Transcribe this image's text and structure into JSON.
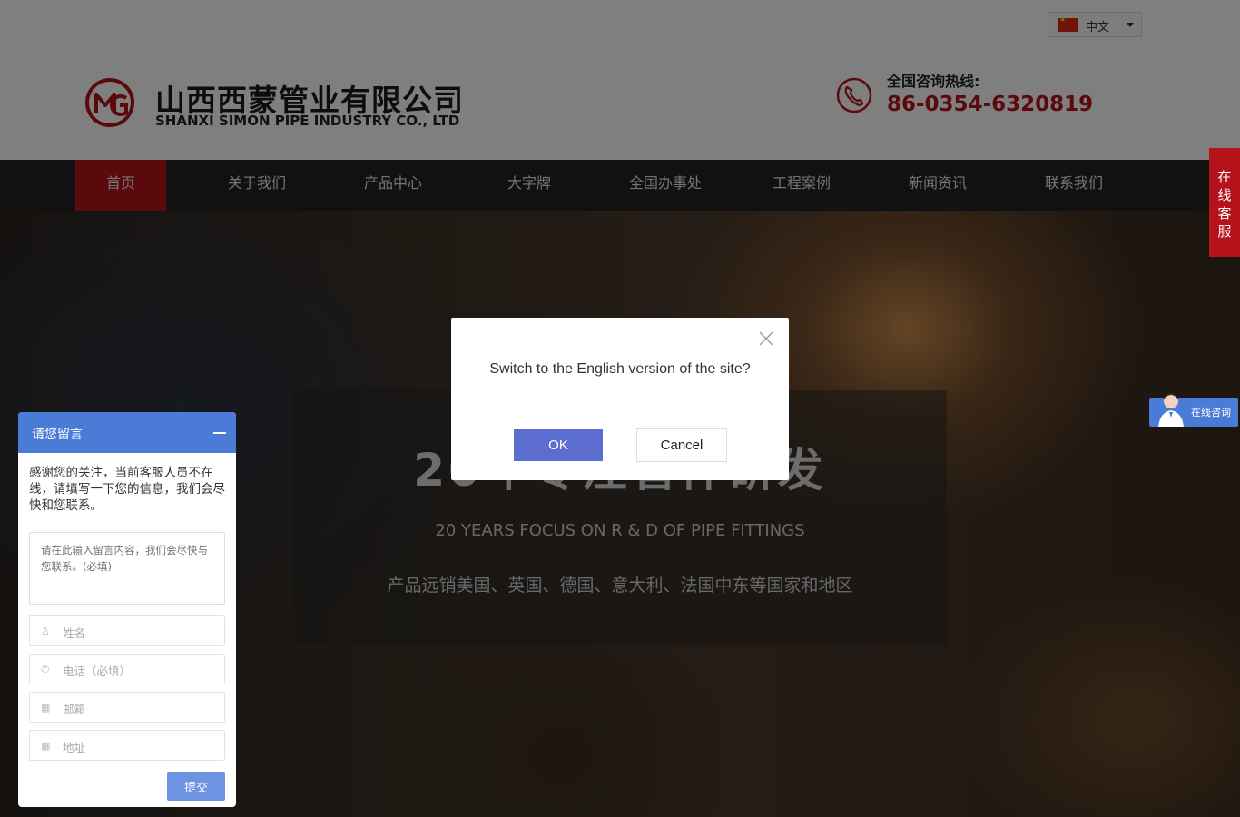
{
  "header": {
    "company_cn": "山西西蒙管业有限公司",
    "company_en": "SHANXI SIMON PIPE INDUSTRY CO., LTD",
    "language": {
      "flag": "china-flag-icon",
      "label": "中文"
    },
    "hotline_label": "全国咨询热线:",
    "hotline_number": "86-0354-6320819"
  },
  "nav": {
    "items": [
      {
        "label": "首页",
        "active": true
      },
      {
        "label": "关于我们"
      },
      {
        "label": "产品中心"
      },
      {
        "label": "大字牌"
      },
      {
        "label": "全国办事处"
      },
      {
        "label": "工程案例"
      },
      {
        "label": "新闻资讯"
      },
      {
        "label": "联系我们"
      }
    ]
  },
  "hero": {
    "title": "20年专注管件研发",
    "subtitle_en": "20 YEARS FOCUS ON R & D OF PIPE FITTINGS",
    "subtitle_cn": "产品远销美国、英国、德国、意大利、法国中东等国家和地区"
  },
  "side_tab": {
    "chars": [
      "在",
      "线",
      "客",
      "服"
    ]
  },
  "consult_badge": {
    "label": "在线咨询"
  },
  "message_widget": {
    "title": "请您留言",
    "intro": "感谢您的关注，当前客服人员不在线，请填写一下您的信息，我们会尽快和您联系。",
    "textarea_placeholder": "请在此输入留言内容，我们会尽快与您联系。(必填)",
    "fields": [
      {
        "placeholder": "姓名",
        "icon": "user-icon"
      },
      {
        "placeholder": "电话（必填）",
        "icon": "phone-icon"
      },
      {
        "placeholder": "邮箱",
        "icon": "email-icon"
      },
      {
        "placeholder": "地址",
        "icon": "address-icon"
      }
    ],
    "submit_label": "提交"
  },
  "dialog": {
    "message": "Switch to the English version of the site?",
    "ok_label": "OK",
    "cancel_label": "Cancel"
  },
  "colors": {
    "brand_red": "#b5121b",
    "nav_bg": "#222222",
    "widget_blue": "#4a7bd6",
    "ok_blue": "#5b6ed0"
  }
}
